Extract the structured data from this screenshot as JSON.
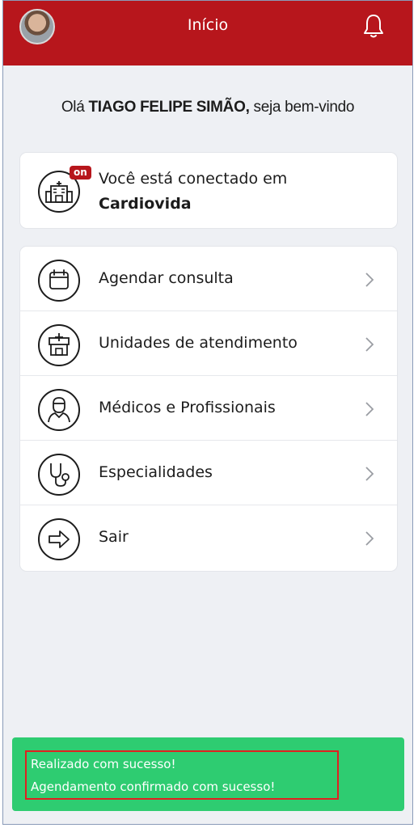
{
  "header": {
    "title": "Início",
    "avatar_icon": "user-avatar",
    "notification_icon": "bell-icon"
  },
  "welcome": {
    "prefix": "Olá ",
    "name": "TIAGO FELIPE SIMÃO,",
    "suffix": " seja bem-vindo"
  },
  "connection": {
    "badge": "on",
    "line1": "Você está conectado em",
    "clinic": "Cardiovida",
    "icon": "hospital-icon"
  },
  "menu": {
    "items": [
      {
        "label": "Agendar consulta",
        "icon": "calendar-icon"
      },
      {
        "label": "Unidades de atendimento",
        "icon": "clinic-building-icon"
      },
      {
        "label": "Médicos e Profissionais",
        "icon": "doctor-icon"
      },
      {
        "label": "Especialidades",
        "icon": "stethoscope-icon"
      },
      {
        "label": "Sair",
        "icon": "arrow-right-icon"
      }
    ]
  },
  "toast": {
    "title": "Realizado com sucesso!",
    "message": "Agendamento confirmado com sucesso!",
    "color": "#2ecc71"
  },
  "colors": {
    "brand": "#b7161c",
    "background": "#eef0f4",
    "success": "#2ecc71",
    "highlight": "#e02020"
  }
}
